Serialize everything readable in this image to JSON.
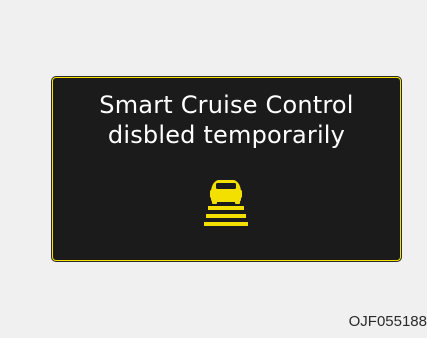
{
  "display": {
    "message_line1": "Smart Cruise Control",
    "message_line2": "disbled temporarily",
    "icon": "smart-cruise-vehicle-icon",
    "colors": {
      "background": "#1b1b1b",
      "border": "#f3e000",
      "text": "#ffffff",
      "icon": "#f3e000"
    }
  },
  "figure": {
    "code": "OJF055188"
  }
}
